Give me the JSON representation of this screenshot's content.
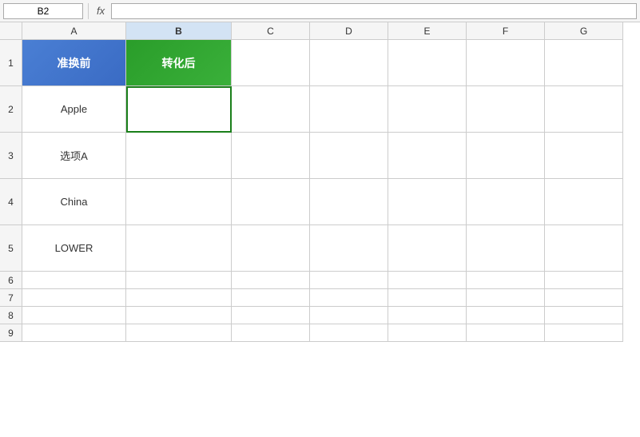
{
  "toolbar": {
    "name_box_value": "B2",
    "fx_label": "fx",
    "formula_value": ""
  },
  "columns": [
    "A",
    "B",
    "C",
    "D",
    "E",
    "F",
    "G"
  ],
  "active_col": "B",
  "rows": [
    {
      "row_num": "1",
      "cells": [
        {
          "col": "A",
          "value": "准换前",
          "type": "header-a"
        },
        {
          "col": "B",
          "value": "转化后",
          "type": "header-b"
        },
        {
          "col": "C",
          "value": "",
          "type": "normal"
        },
        {
          "col": "D",
          "value": "",
          "type": "normal"
        },
        {
          "col": "E",
          "value": "",
          "type": "normal"
        },
        {
          "col": "F",
          "value": "",
          "type": "normal"
        },
        {
          "col": "G",
          "value": "",
          "type": "normal"
        }
      ]
    },
    {
      "row_num": "2",
      "cells": [
        {
          "col": "A",
          "value": "Apple",
          "type": "normal"
        },
        {
          "col": "B",
          "value": "",
          "type": "normal",
          "selected": true
        },
        {
          "col": "C",
          "value": "",
          "type": "normal"
        },
        {
          "col": "D",
          "value": "",
          "type": "normal"
        },
        {
          "col": "E",
          "value": "",
          "type": "normal"
        },
        {
          "col": "F",
          "value": "",
          "type": "normal"
        },
        {
          "col": "G",
          "value": "",
          "type": "normal"
        }
      ]
    },
    {
      "row_num": "3",
      "cells": [
        {
          "col": "A",
          "value": "选项A",
          "type": "normal"
        },
        {
          "col": "B",
          "value": "",
          "type": "normal"
        },
        {
          "col": "C",
          "value": "",
          "type": "normal"
        },
        {
          "col": "D",
          "value": "",
          "type": "normal"
        },
        {
          "col": "E",
          "value": "",
          "type": "normal"
        },
        {
          "col": "F",
          "value": "",
          "type": "normal"
        },
        {
          "col": "G",
          "value": "",
          "type": "normal"
        }
      ]
    },
    {
      "row_num": "4",
      "cells": [
        {
          "col": "A",
          "value": "China",
          "type": "normal"
        },
        {
          "col": "B",
          "value": "",
          "type": "normal"
        },
        {
          "col": "C",
          "value": "",
          "type": "normal"
        },
        {
          "col": "D",
          "value": "",
          "type": "normal"
        },
        {
          "col": "E",
          "value": "",
          "type": "normal"
        },
        {
          "col": "F",
          "value": "",
          "type": "normal"
        },
        {
          "col": "G",
          "value": "",
          "type": "normal"
        }
      ]
    },
    {
      "row_num": "5",
      "cells": [
        {
          "col": "A",
          "value": "LOWER",
          "type": "normal"
        },
        {
          "col": "B",
          "value": "",
          "type": "normal"
        },
        {
          "col": "C",
          "value": "",
          "type": "normal"
        },
        {
          "col": "D",
          "value": "",
          "type": "normal"
        },
        {
          "col": "E",
          "value": "",
          "type": "normal"
        },
        {
          "col": "F",
          "value": "",
          "type": "normal"
        },
        {
          "col": "G",
          "value": "",
          "type": "normal"
        }
      ]
    },
    {
      "row_num": "6",
      "cells": []
    },
    {
      "row_num": "7",
      "cells": []
    },
    {
      "row_num": "8",
      "cells": []
    },
    {
      "row_num": "9",
      "cells": []
    }
  ]
}
